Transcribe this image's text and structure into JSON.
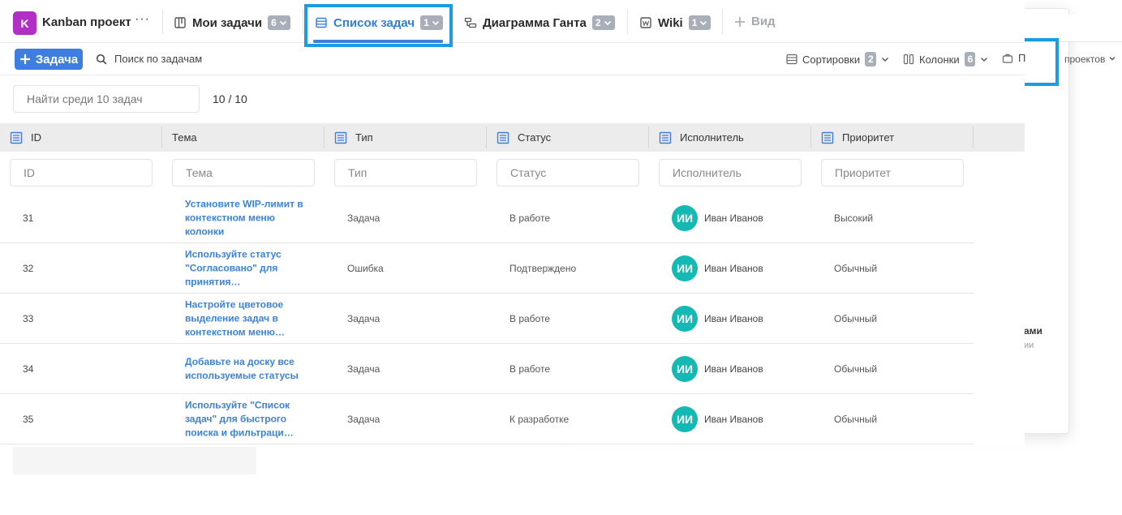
{
  "project": {
    "badge": "K",
    "name": "Kanban проект",
    "more": "···",
    "color": "#b02fc5"
  },
  "tabs": [
    {
      "label": "Мои задачи",
      "count": "6",
      "icon": "board-icon",
      "active": false
    },
    {
      "label": "Список задач",
      "count": "1",
      "icon": "list-icon",
      "active": true
    },
    {
      "label": "Диаграмма Ганта",
      "count": "2",
      "icon": "gantt-icon",
      "active": false
    },
    {
      "label": "Wiki",
      "count": "1",
      "icon": "wiki-icon",
      "active": false
    }
  ],
  "add_view": {
    "label": "Вид"
  },
  "toolbar": {
    "add_task_label": "Задача",
    "search_label": "Поиск по задачам",
    "sorts_label": "Сортировки",
    "sorts_count": "2",
    "columns_label": "Колонки",
    "columns_count": "6",
    "projects_fragment": "П"
  },
  "filter": {
    "placeholder": "Найти среди 10 задач",
    "count": "10 / 10"
  },
  "columns": [
    {
      "label": "ID",
      "filter_placeholder": "ID"
    },
    {
      "label": "Тема",
      "filter_placeholder": "Тема"
    },
    {
      "label": "Тип",
      "filter_placeholder": "Тип"
    },
    {
      "label": "Статус",
      "filter_placeholder": "Статус"
    },
    {
      "label": "Исполнитель",
      "filter_placeholder": "Исполнитель"
    },
    {
      "label": "Приоритет",
      "filter_placeholder": "Приоритет"
    }
  ],
  "rows": [
    {
      "id": "31",
      "subject": "Установите WIP-лимит в контекстном меню колонки",
      "type": "Задача",
      "status": "В работе",
      "avatar": "ИИ",
      "assignee": "Иван Иванов",
      "priority": "Высокий"
    },
    {
      "id": "32",
      "subject": "Используйте статус \"Согласовано\" для принятия…",
      "type": "Ошибка",
      "status": "Подтверждено",
      "avatar": "ИИ",
      "assignee": "Иван Иванов",
      "priority": "Обычный"
    },
    {
      "id": "33",
      "subject": "Настройте цветовое выделение задач в контекстном меню…",
      "type": "Задача",
      "status": "В работе",
      "avatar": "ИИ",
      "assignee": "Иван Иванов",
      "priority": "Обычный"
    },
    {
      "id": "34",
      "subject": "Добавьте на доску все используемые статусы",
      "type": "Задача",
      "status": "В работе",
      "avatar": "ИИ",
      "assignee": "Иван Иванов",
      "priority": "Обычный"
    },
    {
      "id": "35",
      "subject": "Используйте \"Список задач\" для быстрого поиска и фильтраци…",
      "type": "Задача",
      "status": "К разработке",
      "avatar": "ИИ",
      "assignee": "Иван Иванов",
      "priority": "Обычный"
    }
  ],
  "background": {
    "projects_text": "проектов",
    "fragment1": "ами",
    "fragment2": "ии"
  },
  "colors": {
    "accent": "#3d7ee0",
    "highlight": "#1b9be0",
    "avatar": "#14b9b3",
    "link": "#3b83d9"
  }
}
